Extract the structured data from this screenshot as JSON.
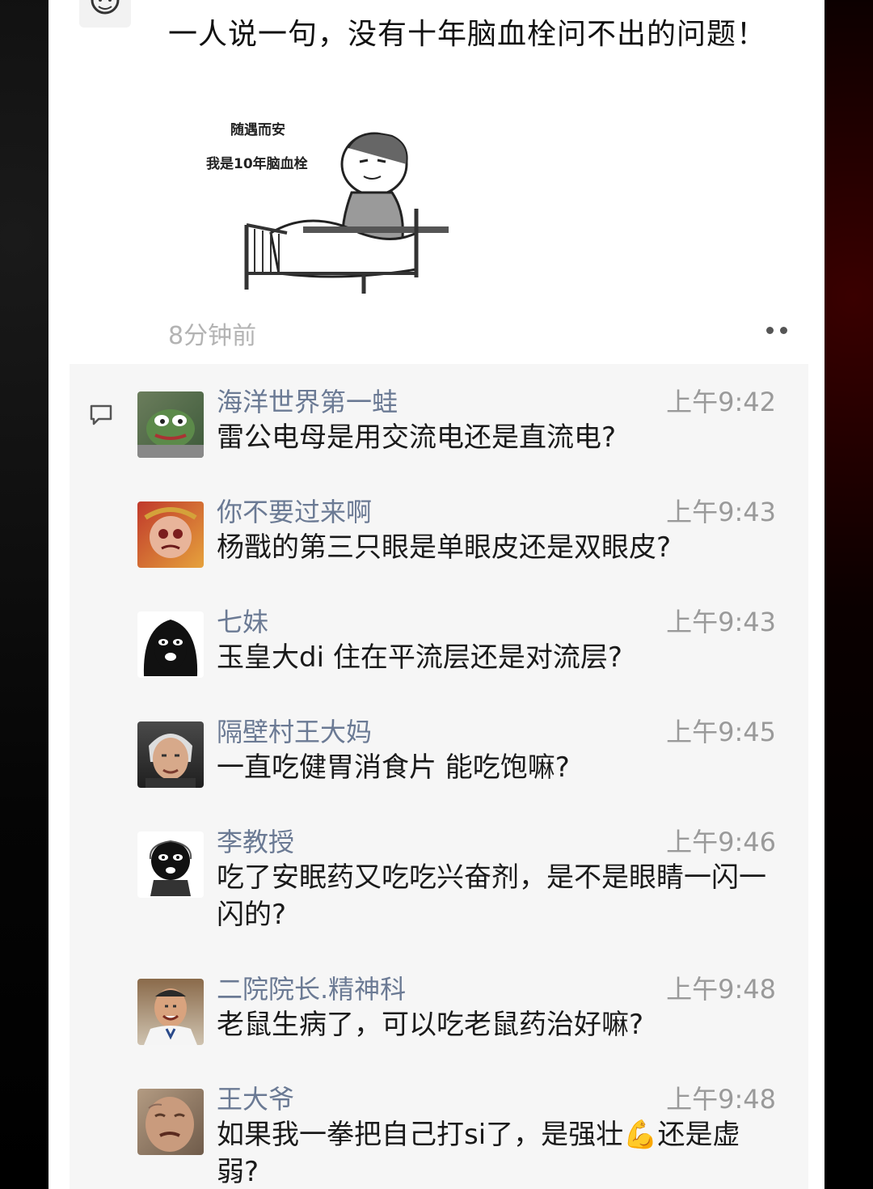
{
  "post": {
    "text": "一人说一句，没有十年脑血栓问不出的问题！",
    "sticker_line1": "随遇而安",
    "sticker_line2": "我是10年脑血栓",
    "time_ago": "8分钟前"
  },
  "comments": [
    {
      "name": "海洋世界第一蛙",
      "time": "上午9:42",
      "text": "雷公电母是用交流电还是直流电?"
    },
    {
      "name": "你不要过来啊",
      "time": "上午9:43",
      "text": "杨戬的第三只眼是单眼皮还是双眼皮?"
    },
    {
      "name": "七妹",
      "time": "上午9:43",
      "text": "玉皇大di 住在平流层还是对流层?"
    },
    {
      "name": "隔壁村王大妈",
      "time": "上午9:45",
      "text": "一直吃健胃消食片 能吃饱嘛?"
    },
    {
      "name": "李教授",
      "time": "上午9:46",
      "text": "吃了安眠药又吃吃兴奋剂，是不是眼睛一闪一闪的?"
    },
    {
      "name": "二院院长.精神科",
      "time": "上午9:48",
      "text": "老鼠生病了，可以吃老鼠药治好嘛?"
    },
    {
      "name": "王大爷",
      "time": "上午9:48",
      "text": "如果我一拳把自己打si了，是强壮💪还是虚弱?"
    }
  ]
}
